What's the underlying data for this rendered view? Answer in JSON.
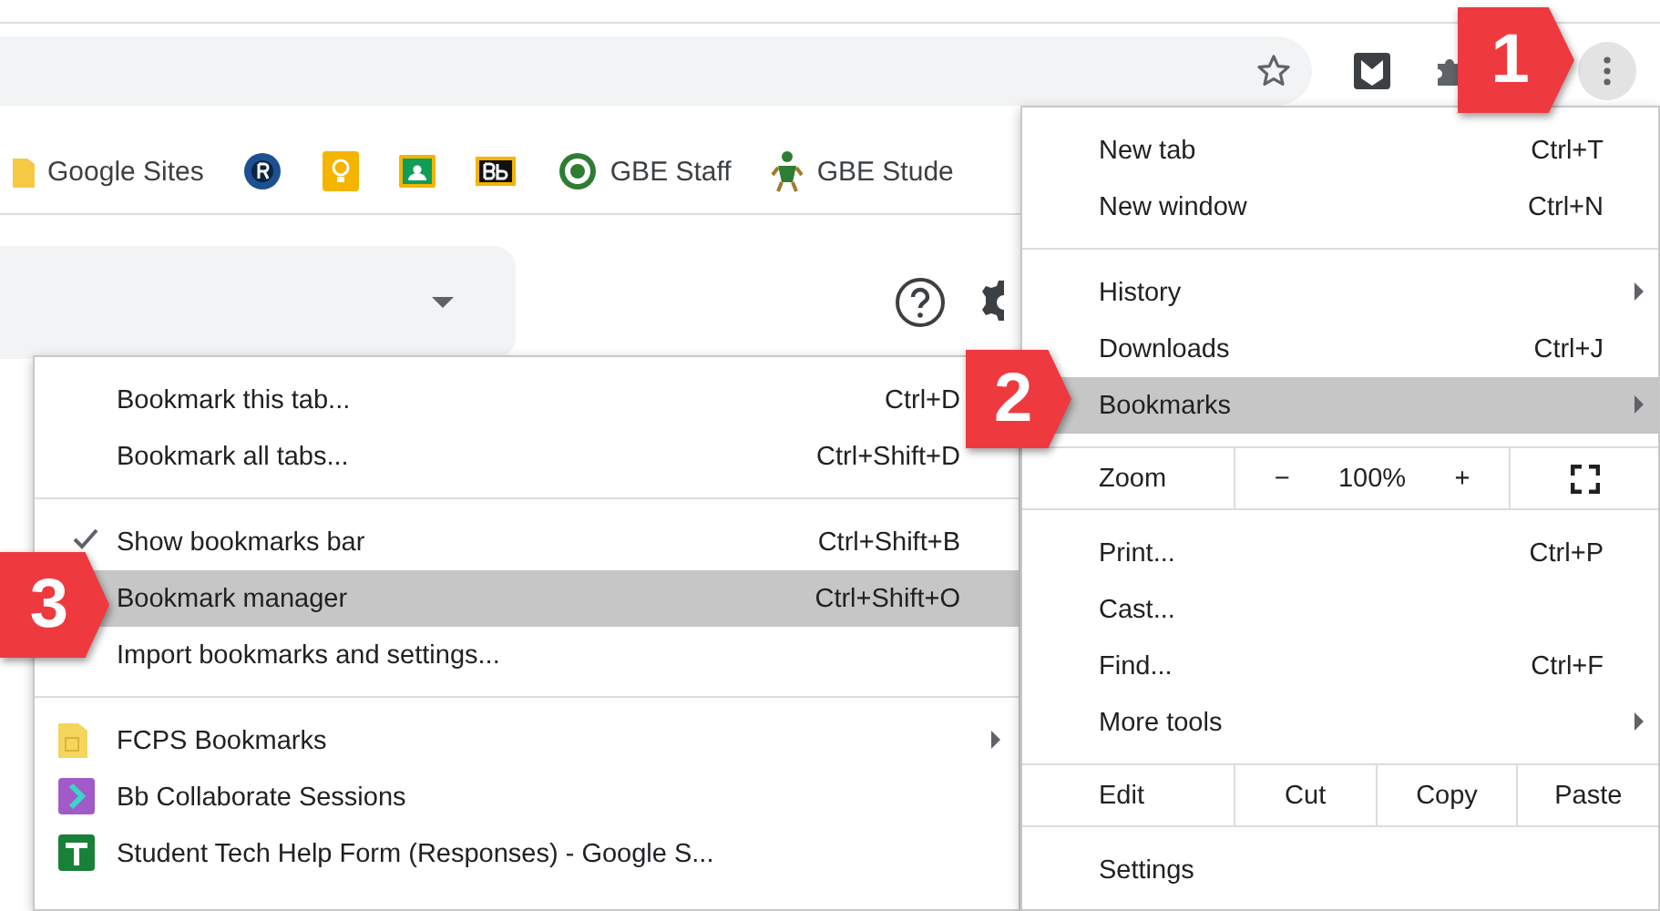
{
  "bookmarks_bar": [
    {
      "kind": "labeled",
      "label": "Google Sites"
    },
    {
      "kind": "icon"
    },
    {
      "kind": "icon"
    },
    {
      "kind": "icon"
    },
    {
      "kind": "icon"
    },
    {
      "kind": "labeled",
      "label": "GBE Staff"
    },
    {
      "kind": "labeled",
      "label": "GBE Stude"
    }
  ],
  "bookmarks_menu": [
    {
      "kind": "action",
      "label": "Bookmark this tab...",
      "shortcut": "Ctrl+D",
      "checked": false,
      "selected": false
    },
    {
      "kind": "action",
      "label": "Bookmark all tabs...",
      "shortcut": "Ctrl+Shift+D",
      "checked": false,
      "selected": false
    },
    {
      "kind": "separator"
    },
    {
      "kind": "action",
      "label": "Show bookmarks bar",
      "shortcut": "Ctrl+Shift+B",
      "checked": true,
      "selected": false
    },
    {
      "kind": "action",
      "label": "Bookmark manager",
      "shortcut": "Ctrl+Shift+O",
      "selected": true
    },
    {
      "kind": "action",
      "label": "Import bookmarks and settings...",
      "checked": false,
      "selected": false
    },
    {
      "kind": "separator"
    },
    {
      "kind": "bookmark",
      "label": "FCPS Bookmarks",
      "selected": false,
      "submenu": true
    },
    {
      "kind": "bookmark",
      "label": "Bb Collaborate Sessions",
      "selected": false,
      "submenu": false
    },
    {
      "kind": "bookmark",
      "label": "Student Tech Help Form (Responses) - Google S...",
      "selected": false,
      "submenu": false
    }
  ],
  "main_menu": [
    {
      "kind": "action",
      "label": "New tab",
      "shortcut": "Ctrl+T",
      "selected": false,
      "submenu": false
    },
    {
      "kind": "action",
      "label": "New window",
      "shortcut": "Ctrl+N",
      "selected": false,
      "submenu": false
    },
    {
      "kind": "separator"
    },
    {
      "kind": "action",
      "label": "History",
      "selected": false,
      "submenu": true
    },
    {
      "kind": "action",
      "label": "Downloads",
      "shortcut": "Ctrl+J",
      "selected": false,
      "submenu": false
    },
    {
      "kind": "action",
      "label": "Bookmarks",
      "selected": true,
      "submenu": true
    },
    {
      "kind": "zoom",
      "label": "Zoom",
      "minus": "−",
      "value": "100%",
      "plus": "+"
    },
    {
      "kind": "action",
      "label": "Print...",
      "shortcut": "Ctrl+P",
      "selected": false,
      "submenu": false
    },
    {
      "kind": "action",
      "label": "Cast...",
      "selected": false,
      "submenu": false
    },
    {
      "kind": "action",
      "label": "Find...",
      "shortcut": "Ctrl+F",
      "selected": false,
      "submenu": false
    },
    {
      "kind": "action",
      "label": "More tools",
      "selected": false,
      "submenu": true
    },
    {
      "kind": "edit",
      "label": "Edit",
      "buttons": [
        "Cut",
        "Copy",
        "Paste"
      ]
    },
    {
      "kind": "action",
      "label": "Settings",
      "selected": false,
      "submenu": false
    }
  ],
  "callouts": [
    {
      "number": "1"
    },
    {
      "number": "2"
    },
    {
      "number": "3"
    }
  ]
}
